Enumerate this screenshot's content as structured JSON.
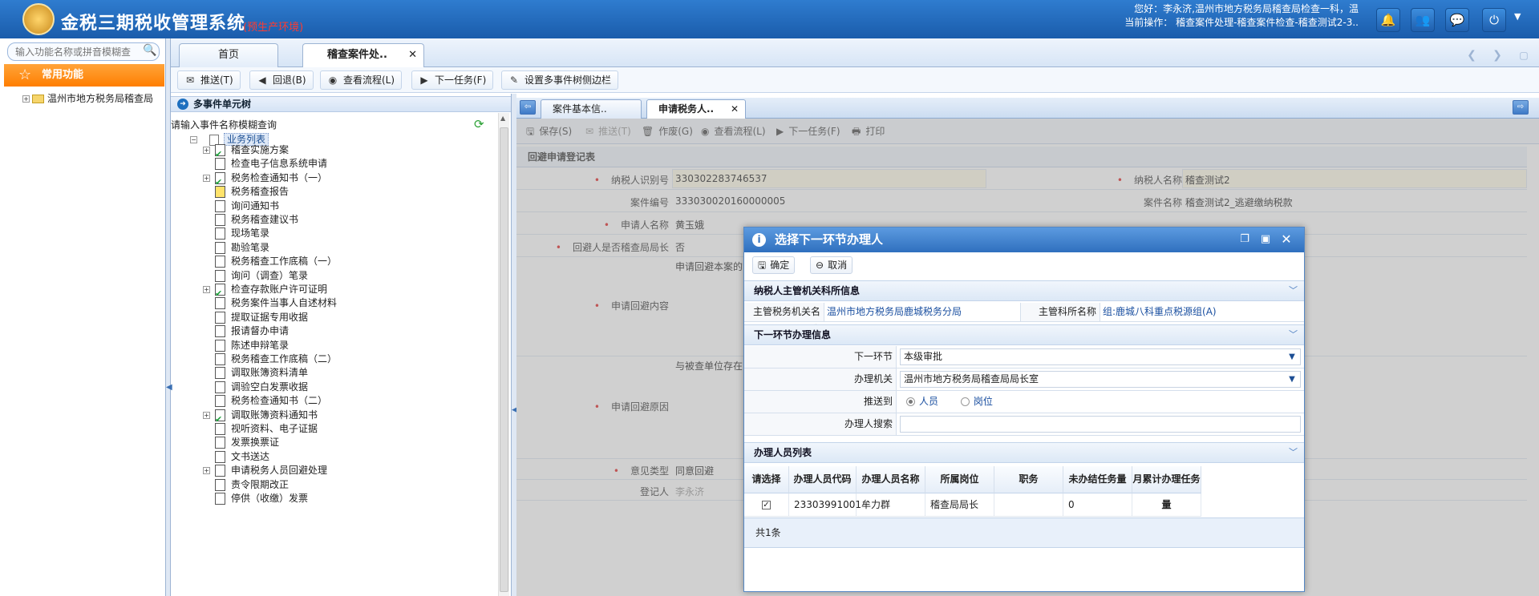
{
  "header": {
    "app_title": "金税三期税收管理系统",
    "env_label": "(预生产环境)",
    "welcome_line1": "您好：李永济,温州市地方税务局稽查局检查一科，温",
    "welcome_line2": "当前操作： 稽查案件处理-稽查案件检查-稽查测试2-3..",
    "icons": [
      "bell-icon",
      "users-icon",
      "chat-icon",
      "power-icon",
      "dropdown-icon"
    ]
  },
  "sidebar": {
    "search_placeholder": "输入功能名称或拼音模糊查",
    "favorites_label": "常用功能",
    "tree_item": "温州市地方税务局稽查局"
  },
  "main_tabs": [
    {
      "label": "首页"
    },
    {
      "label": "稽查案件处.."
    }
  ],
  "toolbar": {
    "push": "推送(T)",
    "back": "回退(B)",
    "view_flow": "查看流程(L)",
    "next_task": "下一任务(F)",
    "set_tree": "设置多事件树侧边栏"
  },
  "tree": {
    "header": "多事件单元树",
    "filter_label": "请输入事件名称模糊查询",
    "root_label": "业务列表",
    "items": [
      {
        "label": "稽查实施方案",
        "expand": true,
        "status": "done"
      },
      {
        "label": "检查电子信息系统申请",
        "expand": false,
        "status": "normal"
      },
      {
        "label": "税务检查通知书（一）",
        "expand": true,
        "status": "done"
      },
      {
        "label": "税务稽查报告",
        "expand": false,
        "status": "warn"
      },
      {
        "label": "询问通知书",
        "expand": false,
        "status": "normal"
      },
      {
        "label": "税务稽查建议书",
        "expand": false,
        "status": "normal"
      },
      {
        "label": "现场笔录",
        "expand": false,
        "status": "normal"
      },
      {
        "label": "勘验笔录",
        "expand": false,
        "status": "normal"
      },
      {
        "label": "税务稽查工作底稿（一）",
        "expand": false,
        "status": "normal"
      },
      {
        "label": "询问（调查）笔录",
        "expand": false,
        "status": "normal"
      },
      {
        "label": "检查存款账户许可证明",
        "expand": true,
        "status": "done"
      },
      {
        "label": "税务案件当事人自述材料",
        "expand": false,
        "status": "normal"
      },
      {
        "label": "提取证据专用收据",
        "expand": false,
        "status": "normal"
      },
      {
        "label": "报请督办申请",
        "expand": false,
        "status": "normal"
      },
      {
        "label": "陈述申辩笔录",
        "expand": false,
        "status": "normal"
      },
      {
        "label": "税务稽查工作底稿（二）",
        "expand": false,
        "status": "normal"
      },
      {
        "label": "调取账簿资料清单",
        "expand": false,
        "status": "normal"
      },
      {
        "label": "调验空白发票收据",
        "expand": false,
        "status": "normal"
      },
      {
        "label": "税务检查通知书（二）",
        "expand": false,
        "status": "normal"
      },
      {
        "label": "调取账簿资料通知书",
        "expand": true,
        "status": "done"
      },
      {
        "label": "视听资料、电子证据",
        "expand": false,
        "status": "normal"
      },
      {
        "label": "发票换票证",
        "expand": false,
        "status": "normal"
      },
      {
        "label": "文书送达",
        "expand": false,
        "status": "normal"
      },
      {
        "label": "申请税务人员回避处理",
        "expand": true,
        "status": "normal"
      },
      {
        "label": "责令限期改正",
        "expand": false,
        "status": "normal"
      },
      {
        "label": "停供（收缴）发票",
        "expand": false,
        "status": "normal"
      }
    ]
  },
  "right_tabs": [
    {
      "label": "案件基本信.."
    },
    {
      "label": "申请税务人.."
    }
  ],
  "right_toolbar": {
    "save": "保存(S)",
    "push": "推送(T)",
    "void": "作废(G)",
    "view_flow": "查看流程(L)",
    "next_task": "下一任务(F)",
    "print": "打印"
  },
  "form": {
    "section": "回避申请登记表",
    "taxpayer_id_label": "纳税人识别号",
    "taxpayer_id": "330302283746537",
    "taxpayer_name_label": "纳税人名称",
    "taxpayer_name": "稽查测试2",
    "case_no_label": "案件编号",
    "case_no": "333030020160000005",
    "case_name_label": "案件名称",
    "case_name": "稽查测试2_逃避缴纳税款",
    "applicant_label": "申请人名称",
    "applicant": "黄玉娥",
    "is_chief_label": "回避人是否稽查局局长",
    "is_chief": "否",
    "content_label": "申请回避内容",
    "content": "申请回避本案的",
    "reason_label": "申请回避原因",
    "reason": "与被查单位存在",
    "opinion_label": "意见类型",
    "opinion": "同意回避",
    "register_label": "登记人",
    "register": "李永济"
  },
  "modal": {
    "title": "选择下一环节办理人",
    "confirm": "确定",
    "cancel": "取消",
    "sec1": "纳税人主管机关科所信息",
    "org_label": "主管税务机关名称",
    "org_value": "温州市地方税务局鹿城税务分局",
    "dept_label": "主管科所名称",
    "dept_value": "组:鹿城八科重点税源组(A)",
    "sec2": "下一环节办理信息",
    "next_step_label": "下一环节",
    "next_step": "本级审批",
    "office_label": "办理机关",
    "office": "温州市地方税务局稽查局局长室",
    "push_to_label": "推送到",
    "push_person": "人员",
    "push_post": "岗位",
    "search_label": "办理人搜索",
    "sec3": "办理人员列表",
    "columns": [
      "请选择",
      "办理人员代码",
      "办理人员名称",
      "所属岗位",
      "职务",
      "未办结任务量",
      "月累计办理任务量"
    ],
    "rows": [
      {
        "checked": "✓",
        "code": "23303991001",
        "name": "牟力群",
        "post": "稽查局局长",
        "duty": "",
        "pending": "0",
        "monthly": ""
      }
    ],
    "count": "共1条"
  }
}
